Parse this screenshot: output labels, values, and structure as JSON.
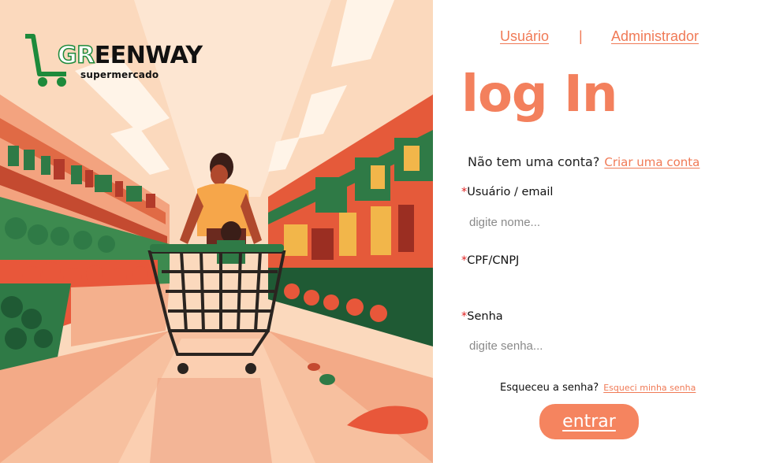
{
  "brand": {
    "logo_prefix": "GR",
    "logo_rest": "EENWAY",
    "tagline": "supermercado"
  },
  "nav": {
    "user_label": "Usuário",
    "separator": "|",
    "admin_label": "Administrador"
  },
  "login": {
    "title": "log In",
    "signup_prompt": "Não tem uma conta?",
    "signup_link": "Criar uma conta",
    "required_mark": "*",
    "fields": {
      "user": {
        "label": "Usuário / email",
        "placeholder": "digite nome..."
      },
      "cpf": {
        "label": "CPF/CNPJ",
        "placeholder": ""
      },
      "password": {
        "label": "Senha",
        "placeholder": "digite senha..."
      }
    },
    "forgot_prompt": "Esqueceu a senha?",
    "forgot_link": "Esqueci minha senha",
    "submit_label": "entrar"
  },
  "colors": {
    "accent": "#f5845f",
    "link": "#f07a56",
    "brand_green": "#1d8a3b",
    "required": "#e02020"
  }
}
